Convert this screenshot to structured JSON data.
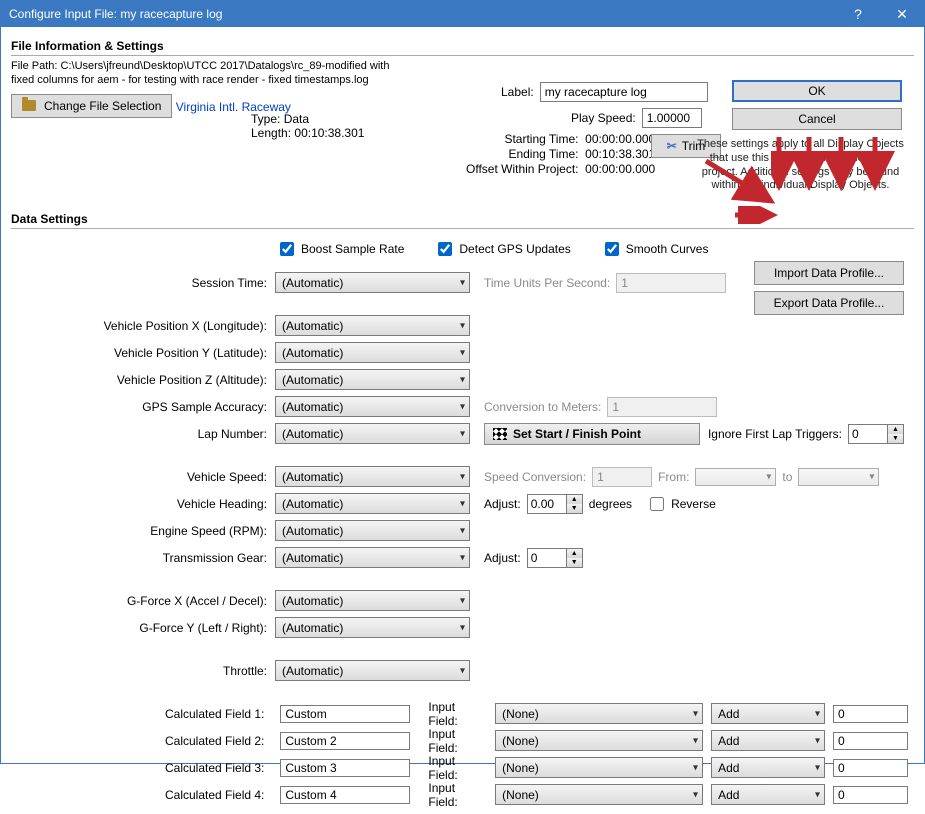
{
  "window": {
    "title": "Configure Input File:  my racecapture log"
  },
  "fileInfo": {
    "heading": "File Information & Settings",
    "pathLabel": "File Path: ",
    "path": "C:\\Users\\jfreund\\Desktop\\UTCC 2017\\Datalogs\\rc_89-modified with fixed columns for aem - for testing with race render - fixed timestamps.log",
    "changeBtn": "Change File Selection",
    "typeLabel": "Type:",
    "typeVal": "Data",
    "lengthLabel": "Length:",
    "lengthVal": "00:10:38.301",
    "startLabel": "Starting Time:",
    "startVal": "00:00:00.000",
    "endLabel": "Ending Time:",
    "endVal": "00:10:38.301",
    "offsetLabel": "Offset Within Project:",
    "offsetVal": "00:00:00.000",
    "trackLink": "Virginia Intl. Raceway",
    "labelLabel": "Label:",
    "labelVal": "my racecapture log",
    "playLabel": "Play Speed:",
    "playVal": "1.00000",
    "trimBtn": "Trim",
    "okBtn": "OK",
    "cancelBtn": "Cancel",
    "helpText": "These settings apply to all Display Objects that use this Input File throughout the project. Additional settings may be found within the individual Display Objects."
  },
  "dataSettings": {
    "heading": "Vehicle Heading:",
    "boost": "Boost Sample Rate",
    "detect": "Detect GPS Updates",
    "smooth": "Smooth Curves",
    "importBtn": "Import Data Profile...",
    "exportBtn": "Export Data Profile...",
    "sessionTime": "Session Time:",
    "tapsLabel": "Time Units Per Second:",
    "tapsVal": "1",
    "lon": "Vehicle Position X (Longitude):",
    "lat": "Vehicle Position Y (Latitude):",
    "alt": "Vehicle Position Z (Altitude):",
    "gpsAcc": "GPS Sample Accuracy:",
    "convM": "Conversion to Meters:",
    "convMVal": "1",
    "lap": "Lap Number:",
    "setStart": "Set Start / Finish Point",
    "ignore": "Ignore First Lap Triggers:",
    "ignoreVal": "0",
    "speed": "Vehicle Speed:",
    "speedConv": "Speed Conversion:",
    "speedConvVal": "1",
    "fromLbl": "From:",
    "toLbl": "to",
    "adjust": "Adjust:",
    "headingVal": "0.00",
    "degrees": "degrees",
    "reverse": "Reverse",
    "rpm": "Engine Speed (RPM):",
    "gear": "Transmission Gear:",
    "gearAdj": "0",
    "gx": "G-Force X (Accel / Decel):",
    "gy": "G-Force Y (Left / Right):",
    "throttle": "Throttle:",
    "auto": "(Automatic)",
    "none": "(None)",
    "add": "Add",
    "inputField": "Input Field:",
    "calc": [
      {
        "label": "Calculated Field 1:",
        "name": "Custom",
        "val": "0"
      },
      {
        "label": "Calculated Field 2:",
        "name": "Custom 2",
        "val": "0"
      },
      {
        "label": "Calculated Field 3:",
        "name": "Custom 3",
        "val": "0"
      },
      {
        "label": "Calculated Field 4:",
        "name": "Custom 4",
        "val": "0"
      }
    ]
  },
  "dsHeading": "Data Settings"
}
